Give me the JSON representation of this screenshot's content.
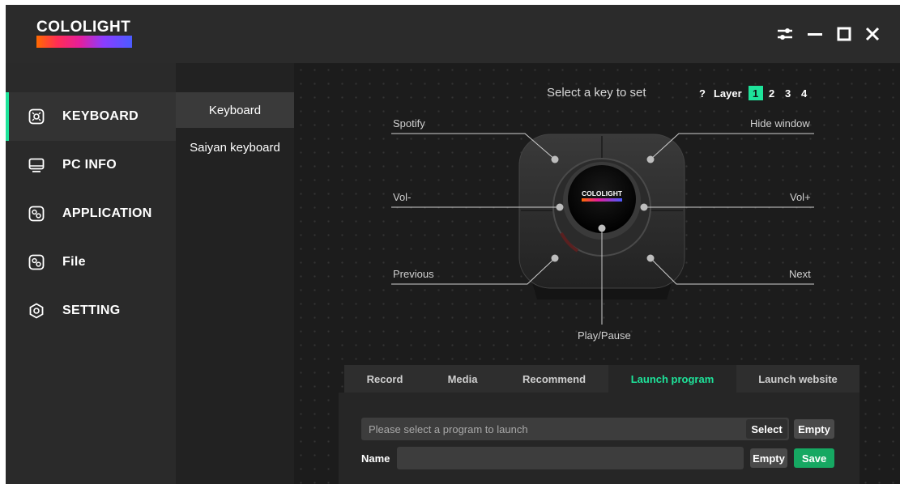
{
  "app": {
    "logo_text": "COLOLIGHT",
    "accent_color": "#1ee39a",
    "window_controls": [
      "settings-sliders-icon",
      "minimize-icon",
      "maximize-icon",
      "close-icon"
    ]
  },
  "sidebar": {
    "items": [
      {
        "label": "KEYBOARD",
        "icon": "keyboard-knob-icon",
        "active": true
      },
      {
        "label": "PC INFO",
        "icon": "monitor-icon",
        "active": false
      },
      {
        "label": "APPLICATION",
        "icon": "application-icon",
        "active": false
      },
      {
        "label": "File",
        "icon": "file-icon",
        "active": false
      },
      {
        "label": "SETTING",
        "icon": "hexagon-settings-icon",
        "active": false
      }
    ]
  },
  "subnav": {
    "items": [
      {
        "label": "Keyboard",
        "active": true
      },
      {
        "label": "Saiyan keyboard",
        "active": false
      }
    ]
  },
  "main": {
    "prompt": "Select a key to set",
    "layer": {
      "help": "?",
      "label": "Layer",
      "options": [
        "1",
        "2",
        "3",
        "4"
      ],
      "selected": "1"
    },
    "device_logo": "COLOLIGHT",
    "keys": {
      "spotify": "Spotify",
      "hide_window": "Hide window",
      "vol_minus": "Vol-",
      "vol_plus": "Vol+",
      "previous": "Previous",
      "next": "Next",
      "play_pause": "Play/Pause"
    },
    "tabs": [
      {
        "label": "Record",
        "active": false
      },
      {
        "label": "Media",
        "active": false
      },
      {
        "label": "Recommend",
        "active": false
      },
      {
        "label": "Launch program",
        "active": true
      },
      {
        "label": "Launch website",
        "active": false
      }
    ],
    "panel": {
      "program_placeholder": "Please select a program to launch",
      "select_label": "Select",
      "empty_label": "Empty",
      "name_label": "Name",
      "name_value": "",
      "name_empty_label": "Empty",
      "save_label": "Save"
    }
  }
}
